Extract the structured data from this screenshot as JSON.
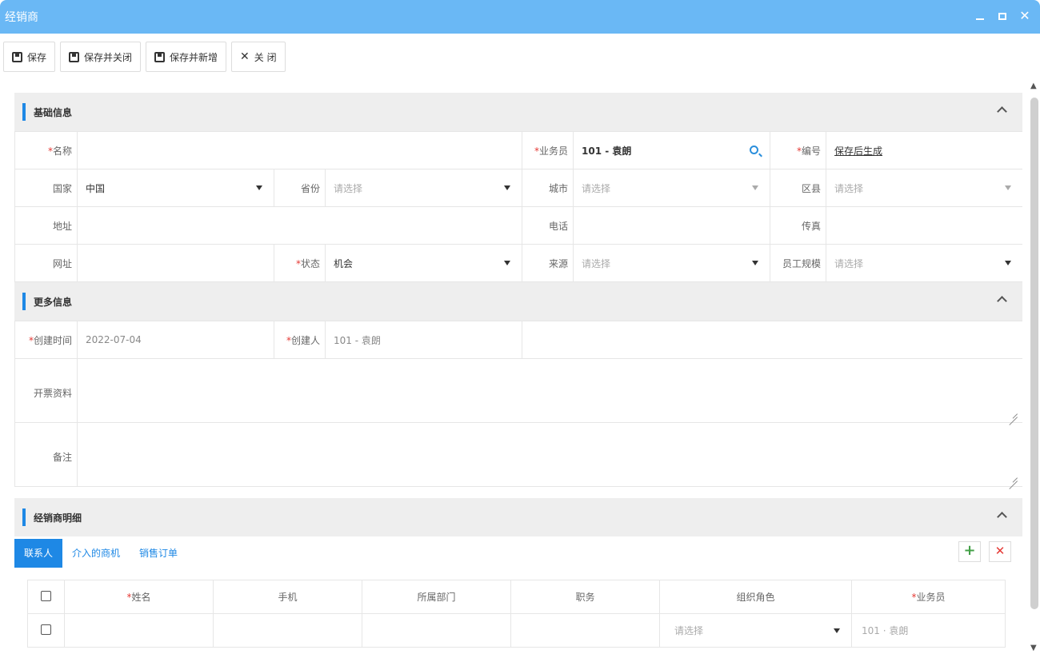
{
  "window": {
    "title": "经销商"
  },
  "toolbar": {
    "save": "保存",
    "save_close": "保存并关闭",
    "save_new": "保存并新增",
    "close": "关 闭"
  },
  "basic": {
    "header": "基础信息",
    "name_label": "名称",
    "name_value": "",
    "salesman_label": "业务员",
    "salesman_value": "101 - 袁朗",
    "code_label": "编号",
    "code_value": "保存后生成",
    "country_label": "国家",
    "country_value": "中国",
    "province_label": "省份",
    "province_value": "请选择",
    "city_label": "城市",
    "city_value": "请选择",
    "district_label": "区县",
    "district_value": "请选择",
    "address_label": "地址",
    "phone_label": "电话",
    "fax_label": "传真",
    "website_label": "网址",
    "status_label": "状态",
    "status_value": "机会",
    "source_label": "来源",
    "source_value": "请选择",
    "staff_label": "员工规模",
    "staff_value": "请选择"
  },
  "more": {
    "header": "更多信息",
    "created_time_label": "创建时间",
    "created_time_value": "2022-07-04",
    "creator_label": "创建人",
    "creator_value": "101 - 袁朗",
    "invoice_label": "开票资料",
    "remark_label": "备注"
  },
  "detail": {
    "header": "经销商明细",
    "tabs": [
      "联系人",
      "介入的商机",
      "销售订单"
    ],
    "columns": [
      "姓名",
      "手机",
      "所属部门",
      "职务",
      "组织角色",
      "业务员"
    ],
    "row": {
      "role": "请选择",
      "salesman": "101 · 袁朗"
    }
  }
}
